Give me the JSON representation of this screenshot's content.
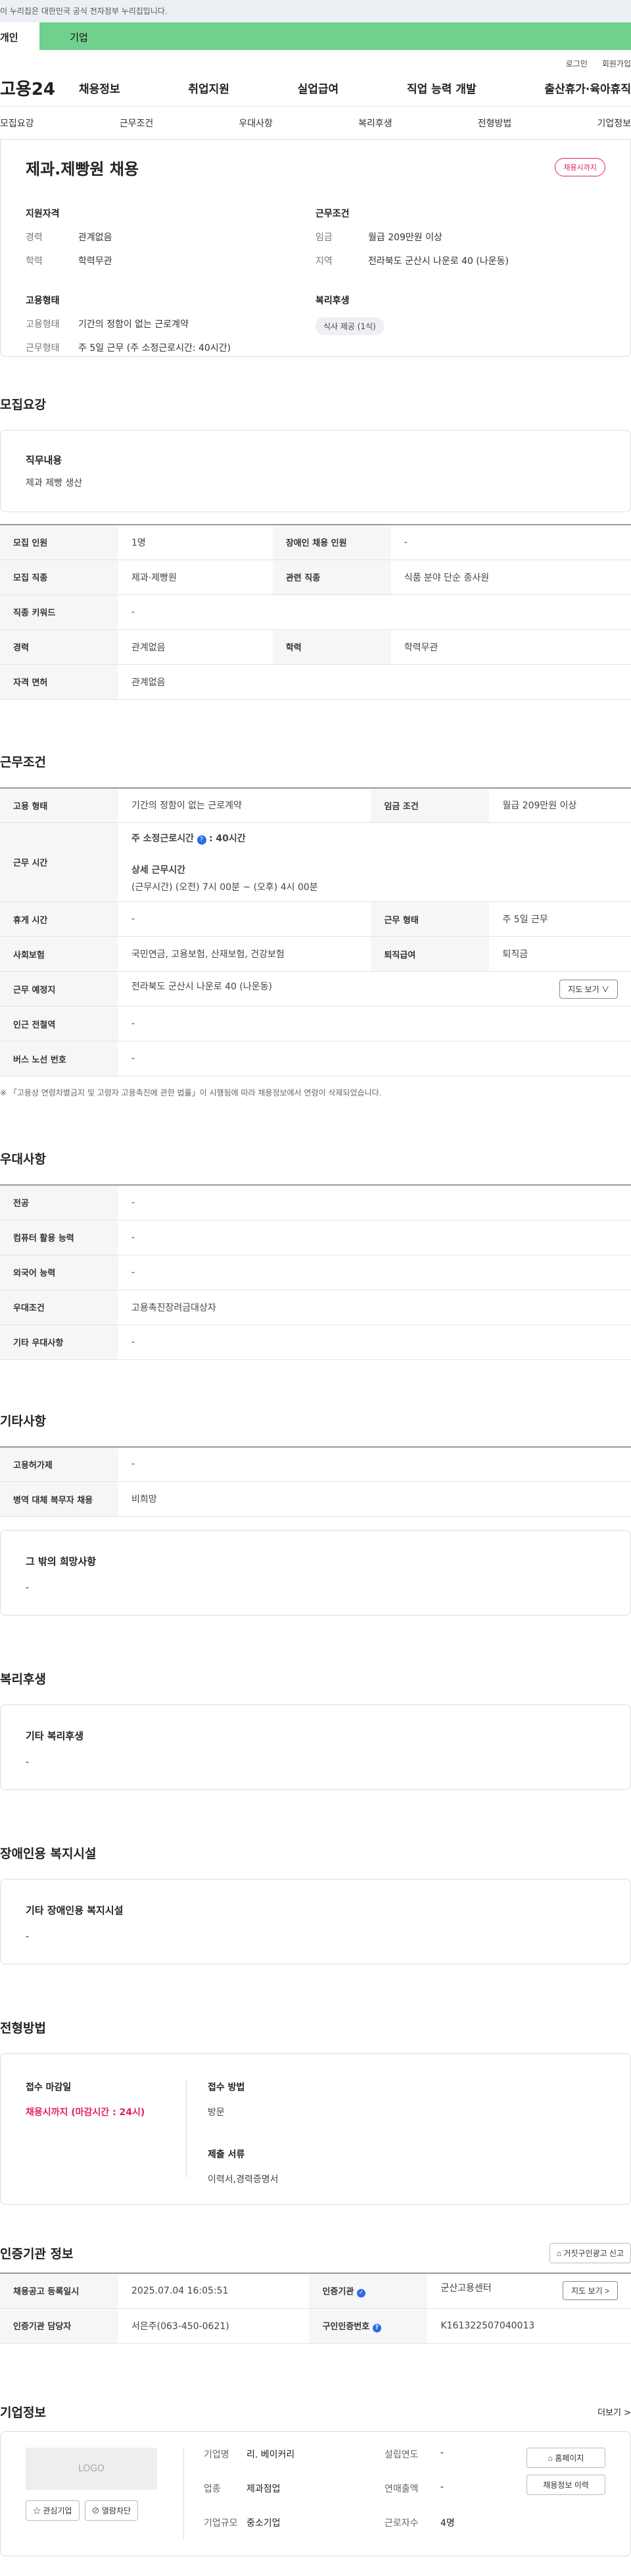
{
  "gov_bar": "이 누리집은 대한민국 공식 전자정부 누리집입니다.",
  "user_tabs": [
    "개인",
    "기업"
  ],
  "top_links": [
    "로그인",
    "회원가입"
  ],
  "logo": "고용24",
  "gnb": [
    "채용정보",
    "취업지원",
    "실업급여",
    "직업 능력 개발",
    "출산휴가·육아휴직"
  ],
  "subnav": [
    "모집요강",
    "근무조건",
    "우대사항",
    "복리후생",
    "전형방법",
    "기업정보"
  ],
  "summary": {
    "title": "제과.제빵원 채용",
    "badge": "채용시까지",
    "qual_title": "지원자격",
    "qual": [
      {
        "k": "경력",
        "v": "관계없음"
      },
      {
        "k": "학력",
        "v": "학력무관"
      }
    ],
    "cond_title": "근무조건",
    "cond": [
      {
        "k": "임금",
        "v": "월급 209만원 이상"
      },
      {
        "k": "지역",
        "v": "전라북도 군산시 나운로 40 (나운동)"
      }
    ],
    "emp_title": "고용형태",
    "emp": [
      {
        "k": "고용형태",
        "v": "기간의 정함이 없는 근로계약"
      },
      {
        "k": "근무형태",
        "v": "주 5일 근무 (주 소정근로시간: 40시간)"
      }
    ],
    "welfare_title": "복리후생",
    "welfare_chip": "식사 제공 (1식)"
  },
  "recruit": {
    "title": "모집요강",
    "duty_label": "직무내용",
    "duty_value": "제과 제빵 생산",
    "rows": [
      [
        {
          "k": "모집 인원",
          "v": "1명"
        },
        {
          "k": "장애인 채용 인원",
          "v": "-"
        }
      ],
      [
        {
          "k": "모집 직종",
          "v": "제과·제빵원"
        },
        {
          "k": "관련 직종",
          "v": "식품 분야 단순 종사원"
        }
      ],
      [
        {
          "k": "직종 키워드",
          "v": "-"
        }
      ],
      [
        {
          "k": "경력",
          "v": "관계없음"
        },
        {
          "k": "학력",
          "v": "학력무관"
        }
      ],
      [
        {
          "k": "자격 면허",
          "v": "관계없음"
        }
      ]
    ]
  },
  "work": {
    "title": "근무조건",
    "emp_type_k": "고용 형태",
    "emp_type_v": "기간의 정함이 없는 근로계약",
    "wage_k": "임금 조건",
    "wage_v": "월급 209만원 이상",
    "hours_k": "근무 시간",
    "hours_week": "주 소정근로시간",
    "hours_week_v": ": 40시간",
    "hours_detail_label": "상세 근무시간",
    "hours_detail": "(근무시간) (오전) 7시 00분 ~ (오후) 4시 00분",
    "rest_k": "휴게 시간",
    "rest_v": "-",
    "form_k": "근무 형태",
    "form_v": "주 5일 근무",
    "ins_k": "사회보험",
    "ins_v": "국민연금, 고용보험, 산재보험, 건강보험",
    "ret_k": "퇴직급여",
    "ret_v": "퇴직금",
    "place_k": "근무 예정지",
    "place_v": "전라북도 군산시 나운로 40 (나운동)",
    "map_btn": "지도 보기 ∨",
    "station_k": "인근 전철역",
    "station_v": "-",
    "bus_k": "버스 노선 번호",
    "bus_v": "-",
    "note": "※ 「고용상 연령차별금지 및 고령자 고용촉진에 관한 법률」이 시행됨에 따라 채용정보에서 연령이 삭제되었습니다."
  },
  "pref": {
    "title": "우대사항",
    "rows": [
      {
        "k": "전공",
        "v": "-"
      },
      {
        "k": "컴퓨터 활용 능력",
        "v": "-"
      },
      {
        "k": "외국어 능력",
        "v": "-"
      },
      {
        "k": "우대조건",
        "v": "고용촉진장려금대상자"
      },
      {
        "k": "기타 우대사항",
        "v": "-"
      }
    ]
  },
  "etc": {
    "title": "기타사항",
    "rows": [
      {
        "k": "고용허가제",
        "v": "-"
      },
      {
        "k": "병역 대체 복무자 채용",
        "v": "비희망"
      }
    ],
    "hope_title": "그 밖의 희망사항",
    "hope_value": "-"
  },
  "welfare": {
    "title": "복리후생",
    "label": "기타 복리후생",
    "value": "-"
  },
  "disabled": {
    "title": "장애인용 복지시설",
    "label": "기타 장애인용 복지시설",
    "value": "-"
  },
  "selection": {
    "title": "전형방법",
    "deadline_label": "접수 마감일",
    "deadline_value": "채용시까지 (마감시간 : 24시)",
    "method_label": "접수 방법",
    "method_value": "방문",
    "docs_label": "제출 서류",
    "docs_value": "이력서,경력증명서"
  },
  "auth": {
    "title": "인증기관 정보",
    "report_btn": "거짓구인광고 신고",
    "reg_k": "채용공고 등록일시",
    "reg_v": "2025.07.04 16:05:51",
    "org_k": "인증기관",
    "org_v": "군산고용센터",
    "map_btn": "지도 보기 >",
    "mgr_k": "인증기관 담당자",
    "mgr_v": "서은주(063-450-0621)",
    "id_k": "구인인증번호",
    "id_v": "K161322507040013"
  },
  "company": {
    "title": "기업정보",
    "more": "더보기 >",
    "logo_text": "LOGO",
    "fav_btn": "관심기업",
    "block_btn": "열람차단",
    "home_btn": "홈페이지",
    "history_btn": "채용정보 이력",
    "name_k": "기업명",
    "name_v": "리. 베이커리",
    "year_k": "설립연도",
    "year_v": "-",
    "ind_k": "업종",
    "ind_v": "제과점업",
    "sales_k": "연매출액",
    "sales_v": "-",
    "size_k": "기업규모",
    "size_v": "중소기업",
    "emp_k": "근로자수",
    "emp_v": "4명"
  }
}
